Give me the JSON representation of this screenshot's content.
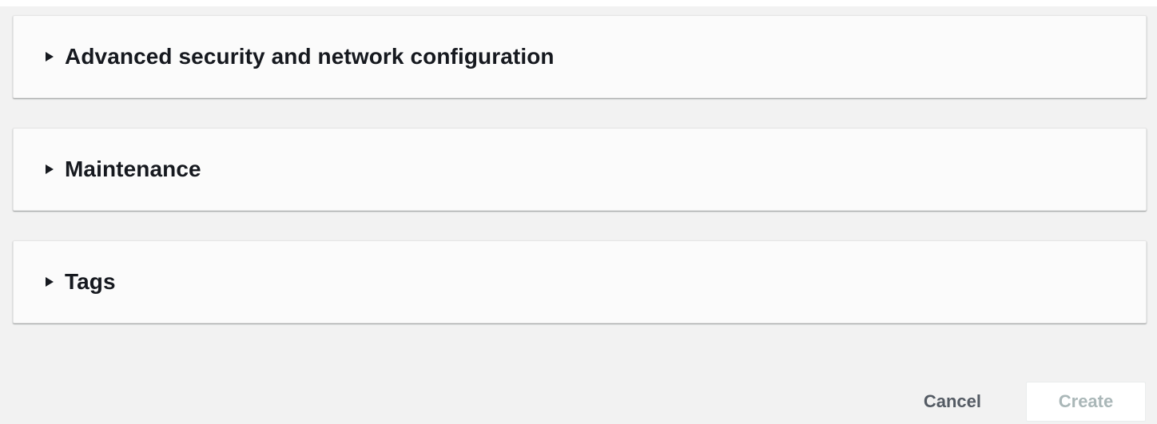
{
  "sections": [
    {
      "title": "Advanced security and network configuration",
      "icon": "caret-right-icon",
      "expanded": false
    },
    {
      "title": "Maintenance",
      "icon": "caret-right-icon",
      "expanded": false
    },
    {
      "title": "Tags",
      "icon": "caret-right-icon",
      "expanded": false
    }
  ],
  "actions": {
    "cancel_label": "Cancel",
    "create_label": "Create",
    "create_disabled": true
  },
  "colors": {
    "background": "#f2f2f2",
    "panel": "#fbfbfb",
    "title_text": "#16191f",
    "cancel_text": "#545b64",
    "disabled_text": "#aab7b8"
  }
}
